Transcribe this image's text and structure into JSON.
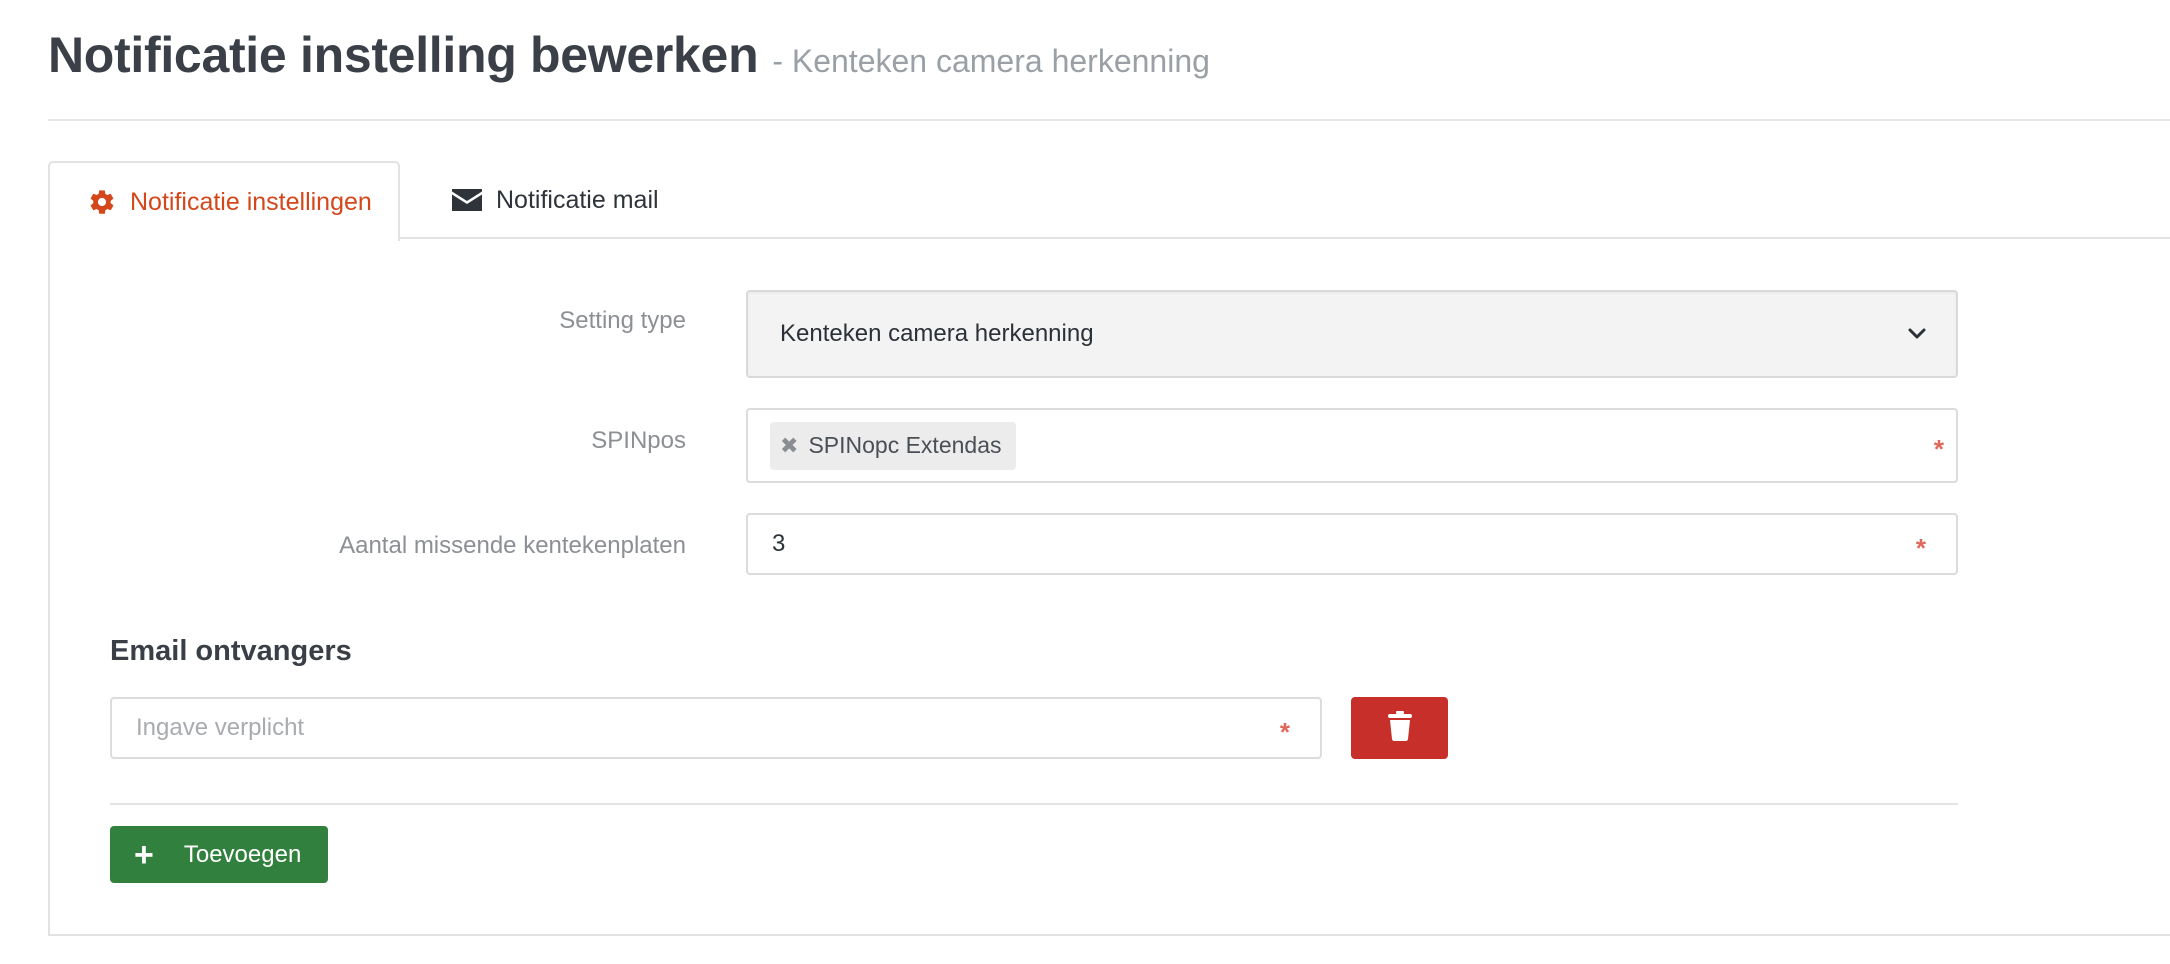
{
  "header": {
    "title": "Notificatie instelling bewerken",
    "subtitle": "- Kenteken camera herkenning"
  },
  "tabs": [
    {
      "label": "Notificatie instellingen",
      "icon": "gear-icon",
      "active": true
    },
    {
      "label": "Notificatie mail",
      "icon": "envelope-icon",
      "active": false
    }
  ],
  "form": {
    "setting_type": {
      "label": "Setting type",
      "value": "Kenteken camera herkenning"
    },
    "spinpos": {
      "label": "SPINpos",
      "tags": [
        "SPINopc Extendas"
      ],
      "required_mark": "*"
    },
    "missing_plates": {
      "label": "Aantal missende kentekenplaten",
      "value": "3",
      "required_mark": "*"
    }
  },
  "email_section": {
    "title": "Email ontvangers",
    "recipient_input": {
      "value": "",
      "placeholder": "Ingave verplicht",
      "required_mark": "*"
    },
    "delete_icon": "trash-icon",
    "add_button": {
      "label": "Toevoegen",
      "icon_glyph": "+"
    }
  },
  "colors": {
    "active_tab": "#d4471b",
    "delete_button": "#c7302a",
    "add_button": "#32803e",
    "required": "#e0685a"
  }
}
